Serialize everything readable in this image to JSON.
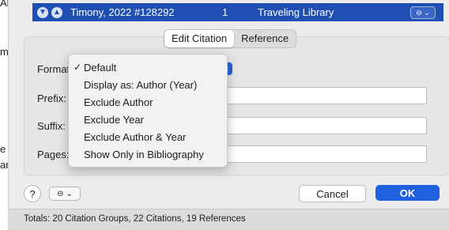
{
  "background_fragments": [
    "Al",
    "m",
    "e f",
    "ar"
  ],
  "citation": {
    "title": "Timony, 2022 #128292",
    "count": "1",
    "library": "Traveling Library",
    "menu_icon": "ellipsis-circle-icon"
  },
  "tabs": [
    {
      "label": "Edit Citation",
      "active": true
    },
    {
      "label": "Reference",
      "active": false
    }
  ],
  "fields": {
    "format_label": "Format:",
    "prefix_label": "Prefix:",
    "suffix_label": "Suffix:",
    "pages_label": "Pages:"
  },
  "format_menu": {
    "items": [
      {
        "label": "Default",
        "checked": true
      },
      {
        "label": "Display as: Author (Year)",
        "checked": false
      },
      {
        "label": "Exclude Author",
        "checked": false
      },
      {
        "label": "Exclude Year",
        "checked": false
      },
      {
        "label": "Exclude Author & Year",
        "checked": false
      },
      {
        "label": "Show Only in Bibliography",
        "checked": false
      }
    ],
    "check_glyph": "✓"
  },
  "buttons": {
    "help": "?",
    "cancel": "Cancel",
    "ok": "OK"
  },
  "status": {
    "totals": "Totals: 20 Citation Groups, 22 Citations, 19 References"
  },
  "colors": {
    "selection": "#1f4fb3",
    "accent": "#1f5fe0"
  }
}
